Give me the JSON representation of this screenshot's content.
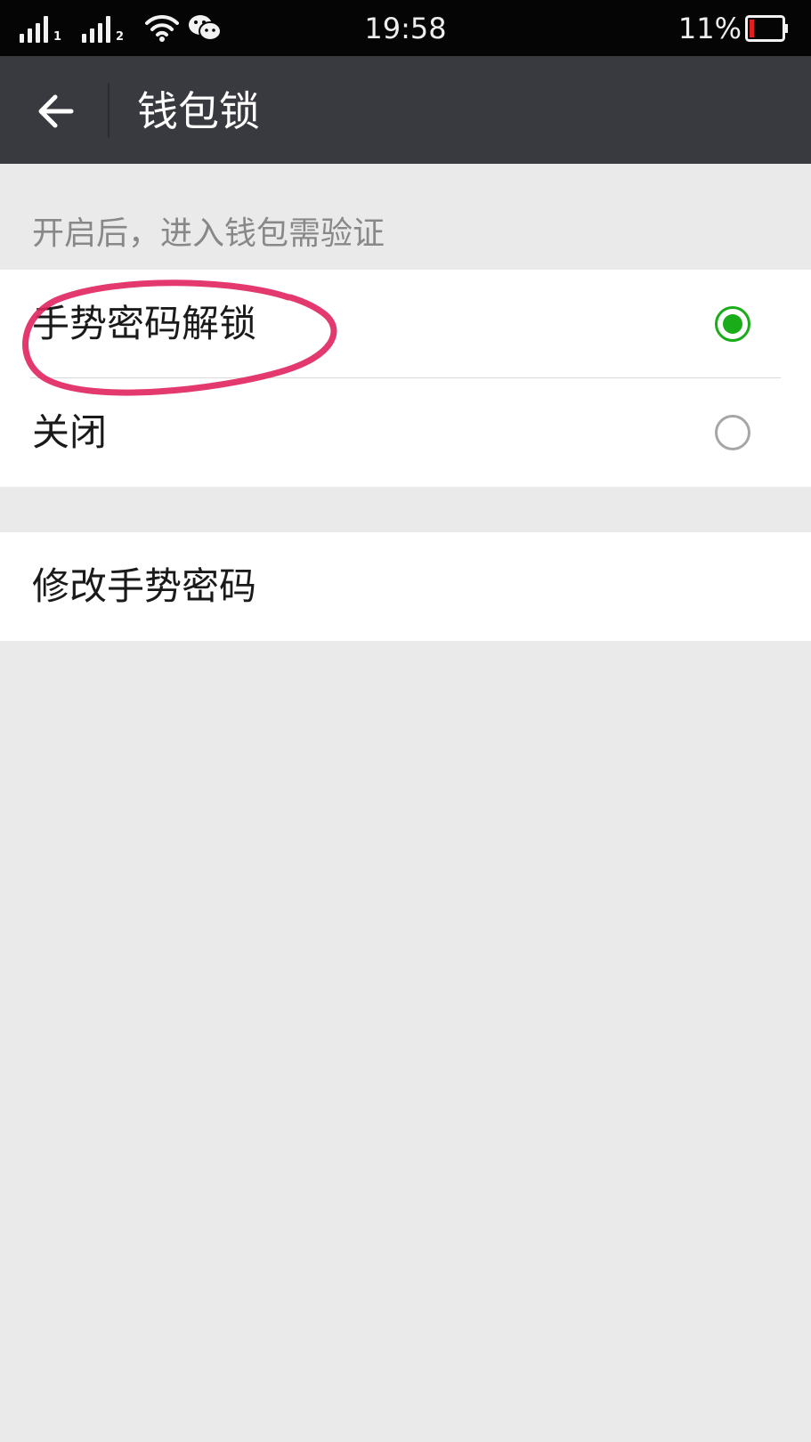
{
  "status_bar": {
    "sim1": "1",
    "sim2": "2",
    "time": "19:58",
    "battery_percent": "11%",
    "battery_level": 0.11,
    "battery_color": "#e02020"
  },
  "header": {
    "title": "钱包锁",
    "back_icon": "arrow-left-icon"
  },
  "section_hint": "开启后，进入钱包需验证",
  "options": [
    {
      "label": "手势密码解锁",
      "checked": true
    },
    {
      "label": "关闭",
      "checked": false
    }
  ],
  "change_password": {
    "label": "修改手势密码"
  },
  "colors": {
    "accent": "#1aad19",
    "annotation": "#e0245e",
    "app_bar": "#393a3f",
    "background": "#eaeaea"
  }
}
